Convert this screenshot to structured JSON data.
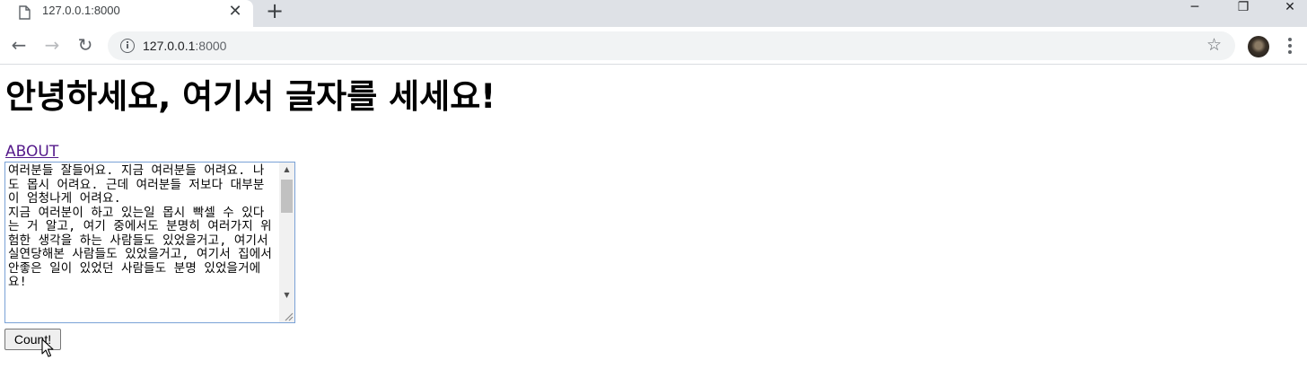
{
  "browser": {
    "tab": {
      "title": "127.0.0.1:8000",
      "close_glyph": "✕"
    },
    "new_tab_glyph": "+",
    "window_controls": {
      "minimize": "─",
      "restore": "❐",
      "close": "✕"
    },
    "nav": {
      "back": "←",
      "forward": "→",
      "reload": "↻"
    },
    "address": {
      "host": "127.0.0.1",
      "port": ":8000"
    },
    "bookmark_glyph": "☆"
  },
  "page": {
    "heading": "안녕하세요, 여기서 글자를 세세요!",
    "about_link": "ABOUT",
    "textarea_value": "여러분들 잘들어요. 지금 여러분들 어려요. 나도 몹시 어려요. 근데 여러분들 저보다 대부분이 엄청나게 어려요.\n지금 여러분이 하고 있는일 몹시 빡셀 수 있다는 거 알고, 여기 중에서도 분명히 여러가지 위험한 생각을 하는 사람들도 있었을거고, 여기서 실연당해본 사람들도 있었을거고, 여기서 집에서 안좋은 일이 있었던 사람들도 분명 있었을거에요!",
    "button_label": "Count!"
  },
  "icons": [
    "page-icon",
    "close-icon",
    "plus-icon",
    "back-arrow-icon",
    "forward-arrow-icon",
    "reload-icon",
    "info-icon",
    "star-icon",
    "avatar",
    "menu-dots-icon",
    "resize-grip-icon",
    "mouse-cursor-icon"
  ]
}
